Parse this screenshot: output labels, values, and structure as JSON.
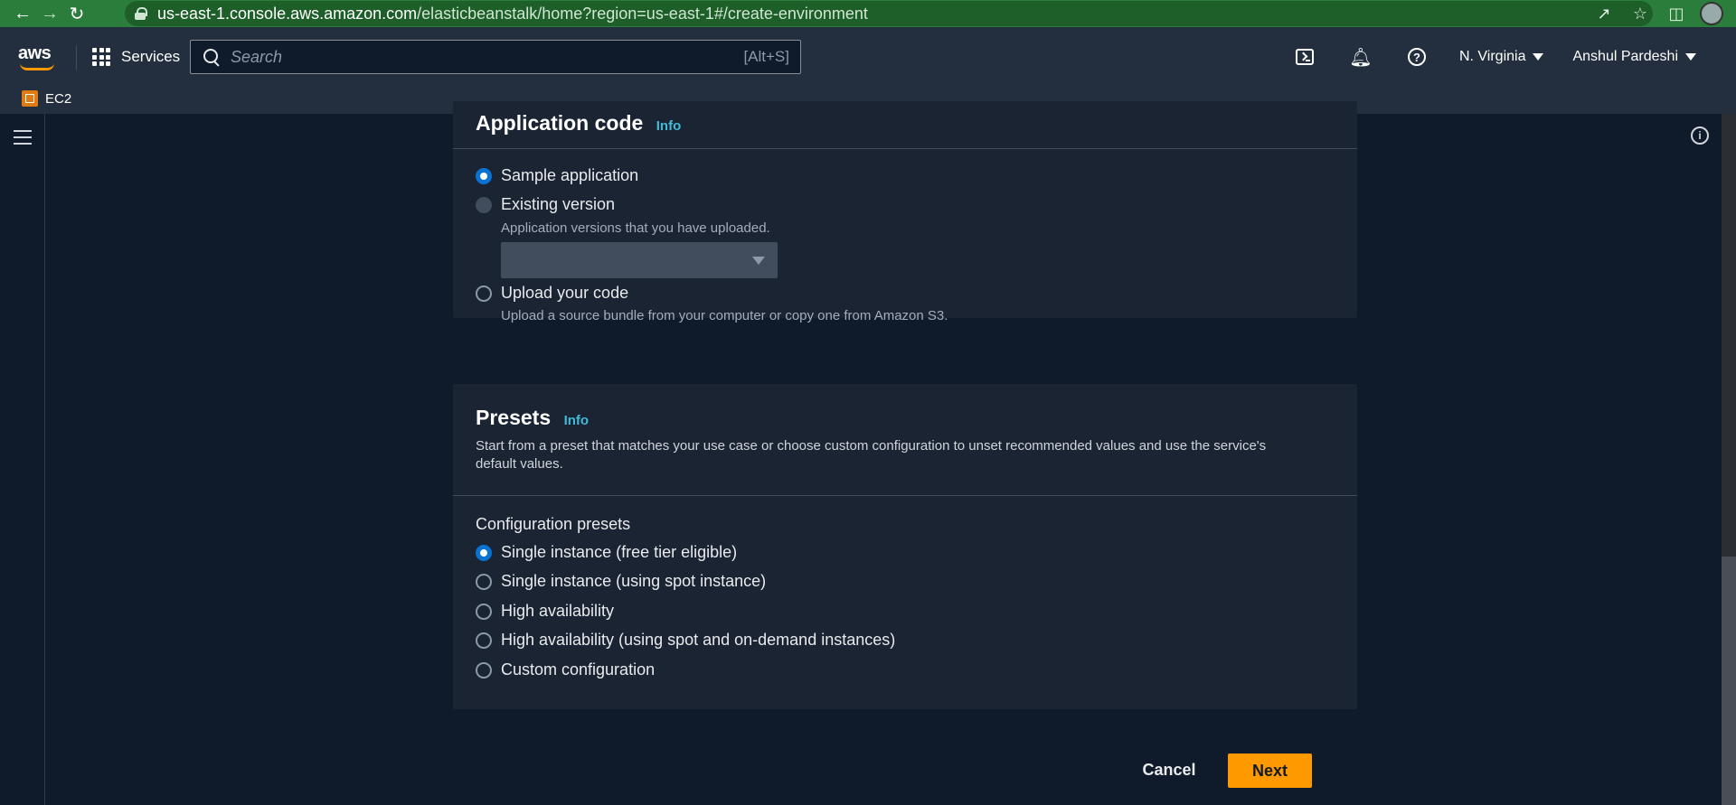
{
  "browser": {
    "url_host": "us-east-1.console.aws.amazon.com",
    "url_path": "/elasticbeanstalk/home?region=us-east-1#/create-environment"
  },
  "aws_nav": {
    "logo_text": "aws",
    "services_label": "Services",
    "search_placeholder": "Search",
    "search_shortcut": "[Alt+S]",
    "region_label": "N. Virginia",
    "user_label": "Anshul Pardeshi",
    "favorites": [
      {
        "label": "EC2"
      }
    ]
  },
  "application_code": {
    "title": "Application code",
    "info_label": "Info",
    "options": [
      {
        "label": "Sample application",
        "checked": true
      },
      {
        "label": "Existing version",
        "hint": "Application versions that you have uploaded.",
        "disabled": true
      },
      {
        "label": "Upload your code",
        "hint": "Upload a source bundle from your computer or copy one from Amazon S3."
      }
    ]
  },
  "presets": {
    "title": "Presets",
    "info_label": "Info",
    "description": "Start from a preset that matches your use case or choose custom configuration to unset recommended values and use the service's default values.",
    "group_label": "Configuration presets",
    "options": [
      {
        "label": "Single instance (free tier eligible)",
        "checked": true
      },
      {
        "label": "Single instance (using spot instance)"
      },
      {
        "label": "High availability"
      },
      {
        "label": "High availability (using spot and on-demand instances)"
      },
      {
        "label": "Custom configuration"
      }
    ]
  },
  "actions": {
    "cancel_label": "Cancel",
    "next_label": "Next"
  },
  "colors": {
    "browser_bar": "#2a7d3a",
    "nav_bg": "#232f3e",
    "page_bg": "#0f1b2a",
    "panel_bg": "#1a2433",
    "accent_blue": "#0972d3",
    "info_link": "#44b9d6",
    "primary_orange": "#ff9900"
  }
}
